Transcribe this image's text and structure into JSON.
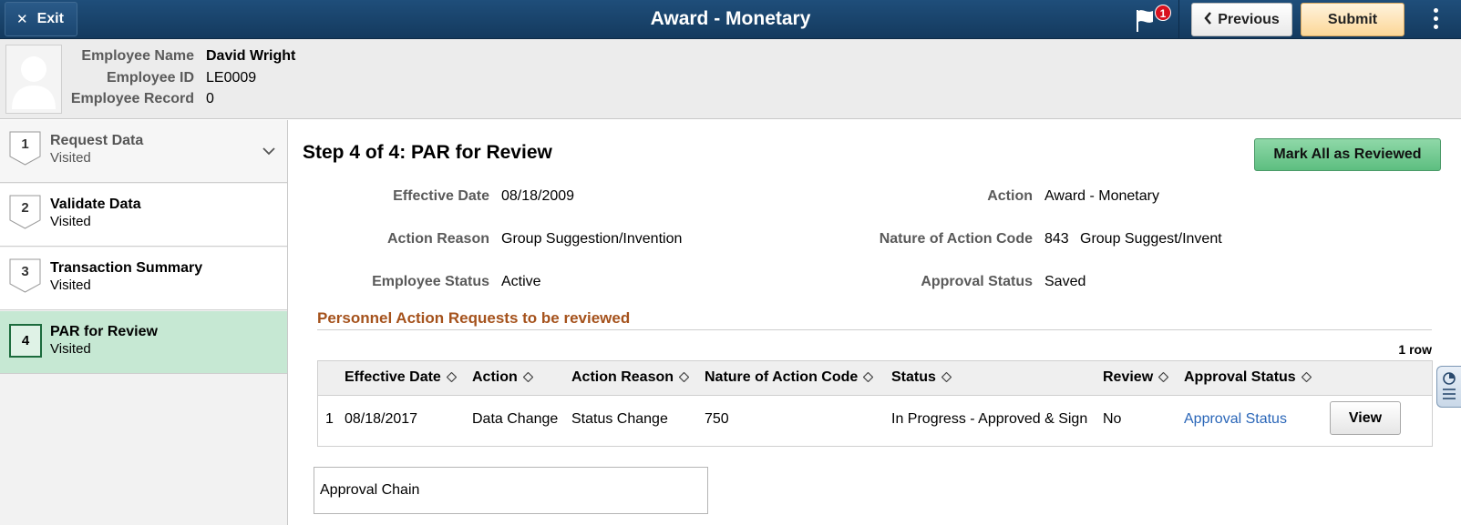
{
  "header": {
    "exit_label": "Exit",
    "title": "Award - Monetary",
    "notification_count": "1",
    "previous_label": "Previous",
    "submit_label": "Submit"
  },
  "employee": {
    "name_label": "Employee Name",
    "name": "David Wright",
    "id_label": "Employee ID",
    "id": "LE0009",
    "record_label": "Employee Record",
    "record": "0"
  },
  "steps": [
    {
      "num": "1",
      "title": "Request Data",
      "status": "Visited"
    },
    {
      "num": "2",
      "title": "Validate Data",
      "status": "Visited"
    },
    {
      "num": "3",
      "title": "Transaction Summary",
      "status": "Visited"
    },
    {
      "num": "4",
      "title": "PAR for Review",
      "status": "Visited"
    }
  ],
  "main": {
    "heading": "Step 4 of 4: PAR for Review",
    "mark_all_label": "Mark All as Reviewed",
    "fields": {
      "effective_date_label": "Effective Date",
      "effective_date": "08/18/2009",
      "action_label": "Action",
      "action": "Award - Monetary",
      "action_reason_label": "Action Reason",
      "action_reason": "Group Suggestion/Invention",
      "noa_code_label": "Nature of Action Code",
      "noa_code": "843",
      "noa_desc": "Group Suggest/Invent",
      "employee_status_label": "Employee Status",
      "employee_status": "Active",
      "approval_status_label": "Approval Status",
      "approval_status": "Saved"
    },
    "section_title": "Personnel Action Requests to be reviewed",
    "row_count": "1 row",
    "columns": [
      "Effective Date",
      "Action",
      "Action Reason",
      "Nature of Action Code",
      "Status",
      "Review",
      "Approval Status"
    ],
    "rows": [
      {
        "index": "1",
        "effective_date": "08/18/2017",
        "action": "Data Change",
        "action_reason": "Status Change",
        "noa_code": "750",
        "status": "In Progress - Approved & Sign",
        "review": "No",
        "approval_status": "Approval Status",
        "view_label": "View"
      }
    ],
    "approval_chain_label": "Approval Chain"
  }
}
